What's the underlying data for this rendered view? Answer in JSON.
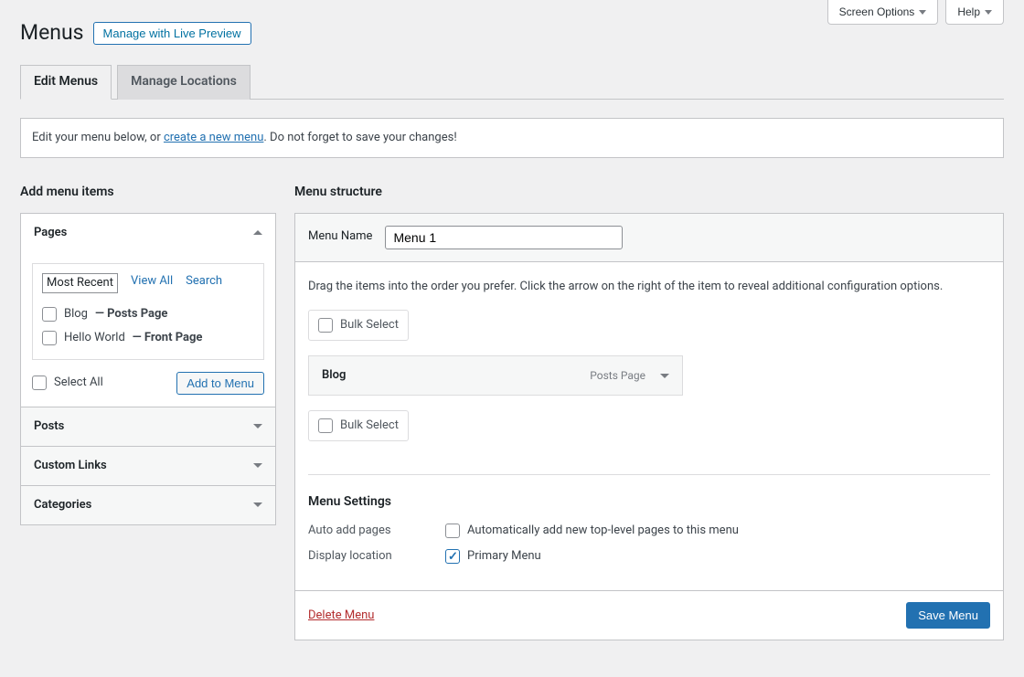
{
  "top": {
    "screen_options": "Screen Options",
    "help": "Help"
  },
  "heading": {
    "title": "Menus",
    "live_preview": "Manage with Live Preview"
  },
  "tabs": {
    "edit": "Edit Menus",
    "locations": "Manage Locations"
  },
  "instructions": {
    "pre": "Edit your menu below, or ",
    "link": "create a new menu",
    "post": ". Do not forget to save your changes!"
  },
  "left": {
    "title": "Add menu items",
    "pages": {
      "label": "Pages",
      "subtabs": {
        "recent": "Most Recent",
        "all": "View All",
        "search": "Search"
      },
      "items": [
        {
          "name": "Blog",
          "suffix": " — Posts Page"
        },
        {
          "name": "Hello World",
          "suffix": " — Front Page"
        }
      ],
      "select_all": "Select All",
      "add": "Add to Menu"
    },
    "posts": "Posts",
    "custom": "Custom Links",
    "categories": "Categories"
  },
  "right": {
    "title": "Menu structure",
    "name_label": "Menu Name",
    "name_value": "Menu 1",
    "hint": "Drag the items into the order you prefer. Click the arrow on the right of the item to reveal additional configuration options.",
    "bulk": "Bulk Select",
    "menu_item": {
      "title": "Blog",
      "type": "Posts Page"
    },
    "settings": {
      "title": "Menu Settings",
      "auto_label": "Auto add pages",
      "auto_check": "Automatically add new top-level pages to this menu",
      "display_label": "Display location",
      "display_check": "Primary Menu"
    },
    "delete": "Delete Menu",
    "save": "Save Menu"
  }
}
